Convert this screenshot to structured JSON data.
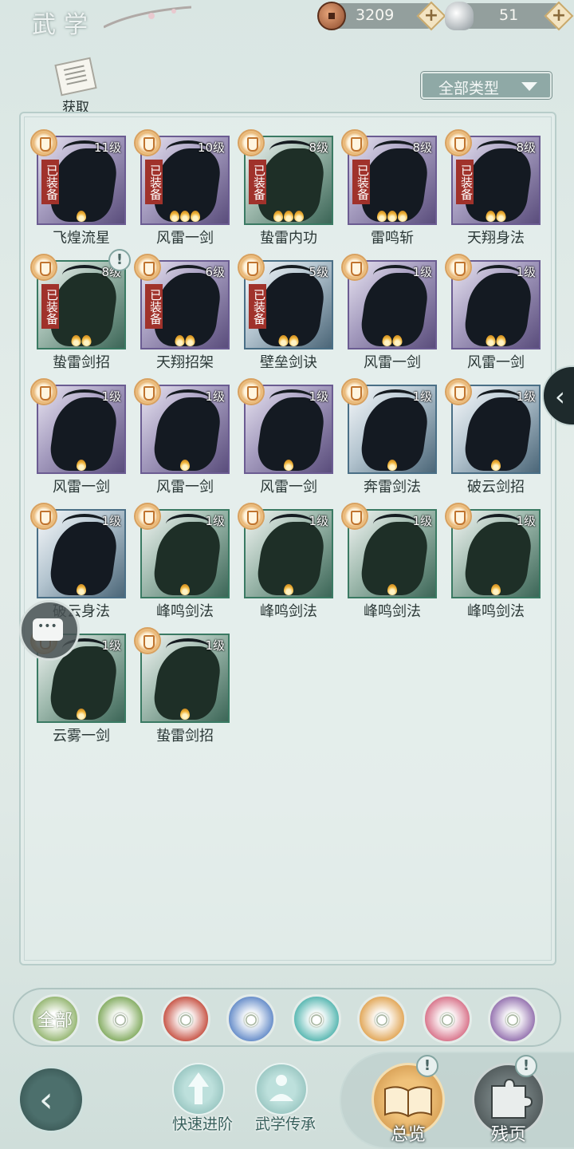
{
  "header": {
    "title": "武学",
    "copper": "3209",
    "silver": "51"
  },
  "acquire_label": "获取",
  "filter_label": "全部类型",
  "equipped_label": "已装备",
  "skills": [
    {
      "name": "飞煌流星",
      "level": "11级",
      "equipped": true,
      "flames": 1,
      "tone": "purple"
    },
    {
      "name": "风雷一剑",
      "level": "10级",
      "equipped": true,
      "flames": 3,
      "tone": "purple"
    },
    {
      "name": "蛰雷内功",
      "level": "8级",
      "equipped": true,
      "flames": 3,
      "tone": "green"
    },
    {
      "name": "雷鸣斩",
      "level": "8级",
      "equipped": true,
      "flames": 3,
      "tone": "purple"
    },
    {
      "name": "天翔身法",
      "level": "8级",
      "equipped": true,
      "flames": 2,
      "tone": "purple"
    },
    {
      "name": "蛰雷剑招",
      "level": "8级",
      "equipped": true,
      "flames": 2,
      "tone": "green"
    },
    {
      "name": "天翔招架",
      "level": "6级",
      "equipped": true,
      "flames": 2,
      "tone": "purple"
    },
    {
      "name": "壁垒剑诀",
      "level": "5级",
      "equipped": true,
      "flames": 2,
      "tone": "blue"
    },
    {
      "name": "风雷一剑",
      "level": "1级",
      "equipped": false,
      "flames": 2,
      "tone": "purple"
    },
    {
      "name": "风雷一剑",
      "level": "1级",
      "equipped": false,
      "flames": 2,
      "tone": "purple"
    },
    {
      "name": "风雷一剑",
      "level": "1级",
      "equipped": false,
      "flames": 1,
      "tone": "purple"
    },
    {
      "name": "风雷一剑",
      "level": "1级",
      "equipped": false,
      "flames": 1,
      "tone": "purple"
    },
    {
      "name": "风雷一剑",
      "level": "1级",
      "equipped": false,
      "flames": 1,
      "tone": "purple"
    },
    {
      "name": "奔雷剑法",
      "level": "1级",
      "equipped": false,
      "flames": 1,
      "tone": "blue"
    },
    {
      "name": "破云剑招",
      "level": "1级",
      "equipped": false,
      "flames": 1,
      "tone": "blue"
    },
    {
      "name": "破云身法",
      "level": "1级",
      "equipped": false,
      "flames": 1,
      "tone": "blue"
    },
    {
      "name": "峰鸣剑法",
      "level": "1级",
      "equipped": false,
      "flames": 1,
      "tone": "green"
    },
    {
      "name": "峰鸣剑法",
      "level": "1级",
      "equipped": false,
      "flames": 1,
      "tone": "green"
    },
    {
      "name": "峰鸣剑法",
      "level": "1级",
      "equipped": false,
      "flames": 1,
      "tone": "green"
    },
    {
      "name": "峰鸣剑法",
      "level": "1级",
      "equipped": false,
      "flames": 1,
      "tone": "green"
    },
    {
      "name": "云雾一剑",
      "level": "1级",
      "equipped": false,
      "flames": 1,
      "tone": "green"
    },
    {
      "name": "蛰雷剑招",
      "level": "1级",
      "equipped": false,
      "flames": 1,
      "tone": "green"
    }
  ],
  "categories": [
    {
      "id": "all",
      "label": "全部",
      "color": "#8fb26a",
      "icon": "all-icon"
    },
    {
      "id": "palm",
      "label": "",
      "color": "#7ea85a",
      "icon": "palm-icon"
    },
    {
      "id": "fire",
      "label": "",
      "color": "#c44b3c",
      "icon": "flame-icon"
    },
    {
      "id": "wave",
      "label": "",
      "color": "#5d86c6",
      "icon": "wave-icon"
    },
    {
      "id": "butterfly",
      "label": "",
      "color": "#4fb3ad",
      "icon": "butterfly-icon"
    },
    {
      "id": "shield",
      "label": "",
      "color": "#e0a24f",
      "icon": "shield-icon"
    },
    {
      "id": "moon",
      "label": "",
      "color": "#d66c84",
      "icon": "moon-icon"
    },
    {
      "id": "flower",
      "label": "",
      "color": "#8f6bab",
      "icon": "flower-icon"
    }
  ],
  "bottom": {
    "quick_advance": "快速进阶",
    "inherit": "武学传承",
    "overview": "总览",
    "pages": "残页"
  }
}
